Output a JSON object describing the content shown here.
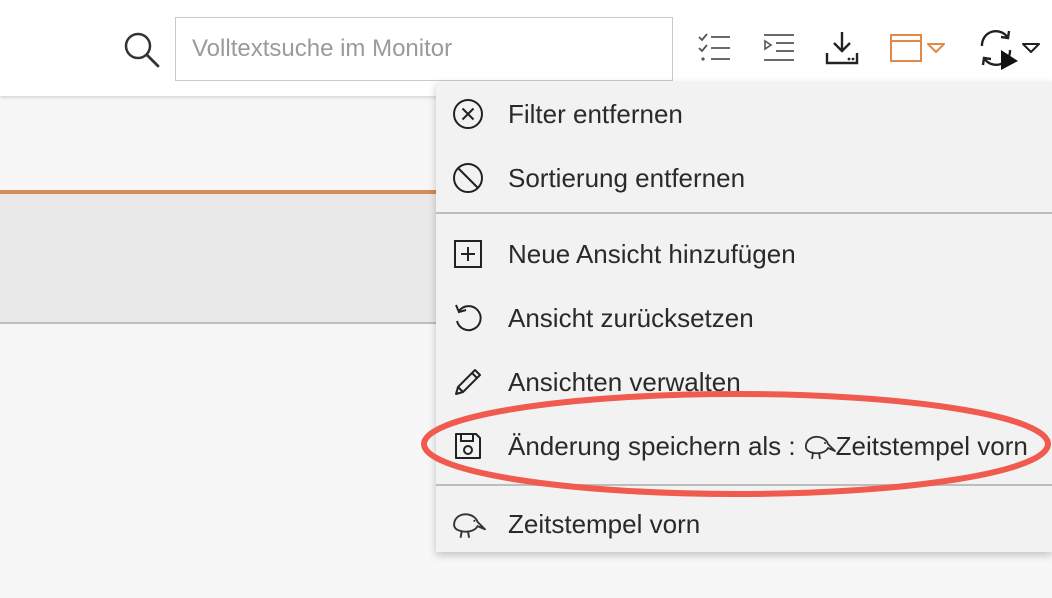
{
  "search": {
    "placeholder": "Volltextsuche im Monitor",
    "value": ""
  },
  "toolbar": {
    "icons": [
      "checklist-icon",
      "indent-list-icon",
      "download-icon",
      "window-icon",
      "refresh-icon"
    ],
    "accent_color": "#e08a4a"
  },
  "menu": {
    "items": [
      {
        "label": "Filter entfernen",
        "icon": "circle-x-icon"
      },
      {
        "label": "Sortierung entfernen",
        "icon": "prohibited-icon"
      },
      {
        "label": "Neue Ansicht hinzufügen",
        "icon": "plus-square-icon"
      },
      {
        "label": "Ansicht zurücksetzen",
        "icon": "undo-icon"
      },
      {
        "label": "Ansichten verwalten",
        "icon": "pencil-icon"
      },
      {
        "label_prefix": "Änderung speichern als :",
        "label_view": "Zeitstempel vorn",
        "icon": "save-icon"
      },
      {
        "label": "Zeitstempel vorn",
        "icon": "kiwi-bird-icon"
      }
    ]
  },
  "colors": {
    "accent": "#d68a55",
    "highlight": "#f05a4f"
  }
}
